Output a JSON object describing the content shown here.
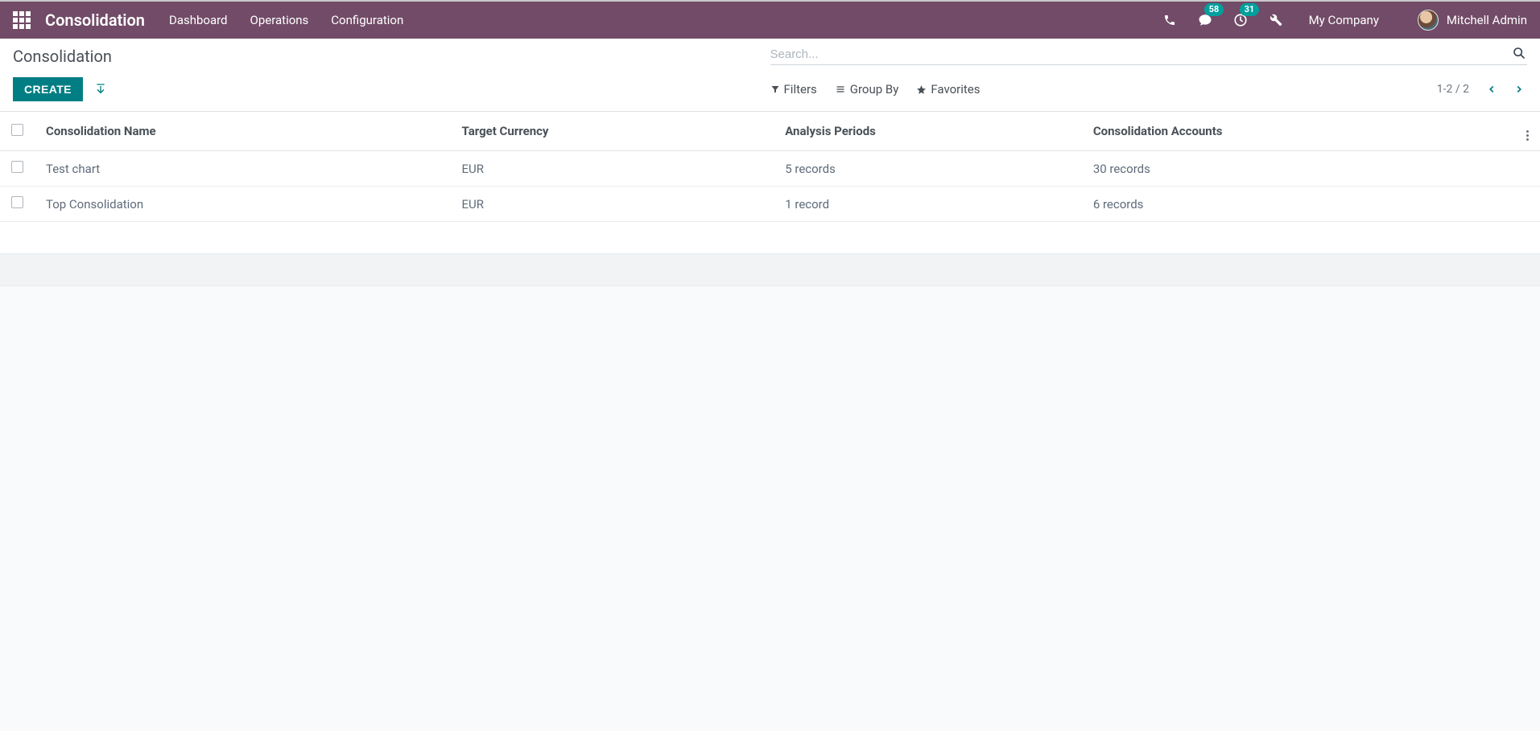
{
  "navbar": {
    "brand": "Consolidation",
    "menu": [
      "Dashboard",
      "Operations",
      "Configuration"
    ],
    "messages_badge": "58",
    "activities_badge": "31",
    "company": "My Company",
    "user": "Mitchell Admin"
  },
  "breadcrumb": "Consolidation",
  "buttons": {
    "create": "CREATE"
  },
  "search": {
    "placeholder": "Search...",
    "filters": "Filters",
    "group_by": "Group By",
    "favorites": "Favorites"
  },
  "pager": {
    "range": "1-2 / 2"
  },
  "table": {
    "headers": {
      "name": "Consolidation Name",
      "currency": "Target Currency",
      "periods": "Analysis Periods",
      "accounts": "Consolidation Accounts"
    },
    "rows": [
      {
        "name": "Test chart",
        "currency": "EUR",
        "periods": "5 records",
        "accounts": "30 records"
      },
      {
        "name": "Top Consolidation",
        "currency": "EUR",
        "periods": "1 record",
        "accounts": "6 records"
      }
    ]
  }
}
